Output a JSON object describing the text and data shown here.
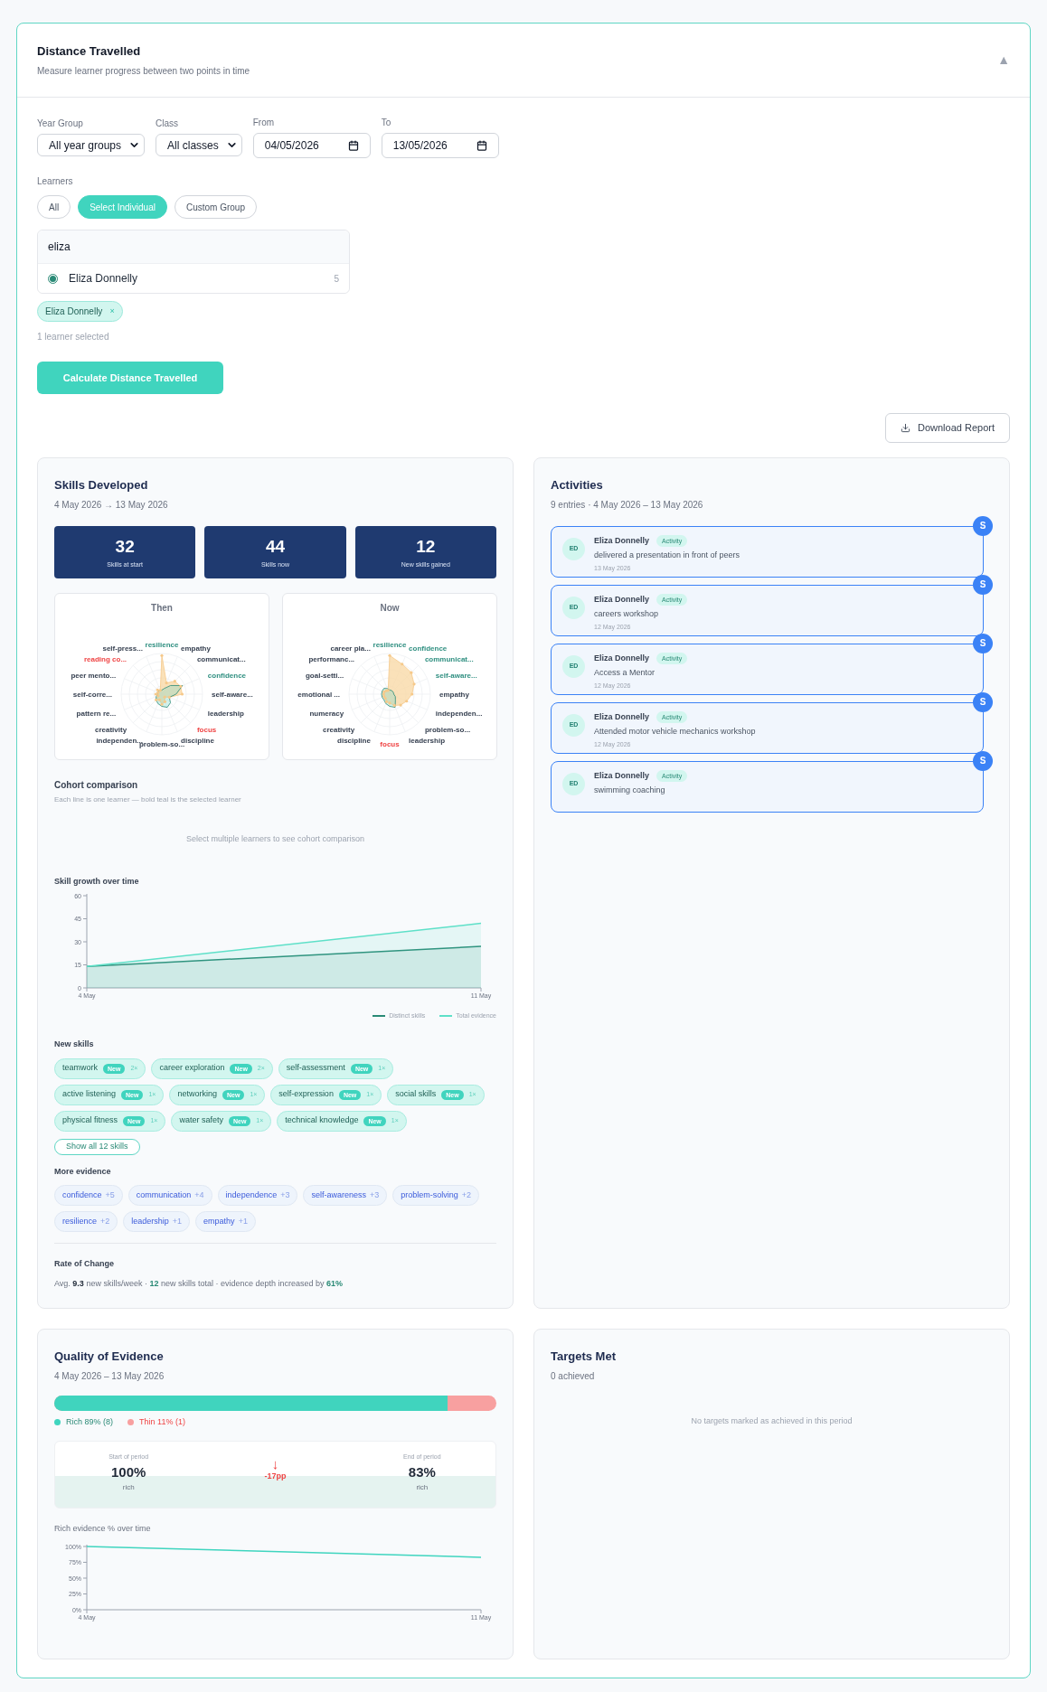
{
  "header": {
    "title": "Distance Travelled",
    "subtitle": "Measure learner progress between two points in time",
    "toggle": "▲"
  },
  "filters": [
    {
      "kind": "select",
      "label": "Year Group",
      "value": "All year groups"
    },
    {
      "kind": "select",
      "label": "Class",
      "value": "All classes"
    },
    {
      "kind": "date",
      "label": "From",
      "value": "04/05/2026"
    },
    {
      "kind": "date",
      "label": "To",
      "value": "13/05/2026"
    }
  ],
  "learners": {
    "label": "Learners",
    "modes": [
      {
        "label": "All",
        "selected": false
      },
      {
        "label": "Select Individual",
        "selected": true
      },
      {
        "label": "Custom Group",
        "selected": false
      }
    ],
    "search": {
      "value": "eliza"
    },
    "results": [
      {
        "name": "Eliza Donnelly",
        "count": "5",
        "selected": true
      }
    ],
    "chips": [
      {
        "label": "Eliza Donnelly",
        "remove": "×"
      }
    ],
    "selected_count": "1 learner selected"
  },
  "calculate_button": "Calculate Distance Travelled",
  "download_button": "Download Report",
  "skills": {
    "title": "Skills Developed",
    "date_range": "4 May 2026 → 13 May 2026",
    "stats": [
      {
        "value": "32",
        "label": "Skills at start"
      },
      {
        "value": "44",
        "label": "Skills now"
      },
      {
        "value": "12",
        "label": "New skills gained"
      }
    ],
    "radars": [
      {
        "title": "Then",
        "labels": [
          {
            "text": "resilience",
            "color": "#2f8f80"
          },
          {
            "text": "self-press...",
            "color": "#374151"
          },
          {
            "text": "empathy",
            "color": "#374151"
          },
          {
            "text": "reading co...",
            "color": "#ef4444"
          },
          {
            "text": "communicat...",
            "color": "#374151"
          },
          {
            "text": "peer mento...",
            "color": "#374151"
          },
          {
            "text": "confidence",
            "color": "#2f8f80"
          },
          {
            "text": "self-corre...",
            "color": "#374151"
          },
          {
            "text": "self-aware...",
            "color": "#374151"
          },
          {
            "text": "pattern re...",
            "color": "#374151"
          },
          {
            "text": "leadership",
            "color": "#374151"
          },
          {
            "text": "creativity",
            "color": "#374151"
          },
          {
            "text": "focus",
            "color": "#ef4444"
          },
          {
            "text": "independen...",
            "color": "#374151"
          },
          {
            "text": "discipline",
            "color": "#374151"
          },
          {
            "text": "problem-so...",
            "color": "#374151"
          }
        ]
      },
      {
        "title": "Now",
        "labels": [
          {
            "text": "resilience",
            "color": "#2f8f80"
          },
          {
            "text": "career pla...",
            "color": "#374151"
          },
          {
            "text": "confidence",
            "color": "#2f8f80"
          },
          {
            "text": "performanc...",
            "color": "#374151"
          },
          {
            "text": "communicat...",
            "color": "#2f8f80"
          },
          {
            "text": "goal-setti...",
            "color": "#374151"
          },
          {
            "text": "self-aware...",
            "color": "#2f8f80"
          },
          {
            "text": "emotional ...",
            "color": "#374151"
          },
          {
            "text": "empathy",
            "color": "#374151"
          },
          {
            "text": "numeracy",
            "color": "#374151"
          },
          {
            "text": "independen...",
            "color": "#374151"
          },
          {
            "text": "creativity",
            "color": "#374151"
          },
          {
            "text": "problem-so...",
            "color": "#374151"
          },
          {
            "text": "discipline",
            "color": "#374151"
          },
          {
            "text": "leadership",
            "color": "#374151"
          },
          {
            "text": "focus",
            "color": "#ef4444"
          }
        ]
      }
    ],
    "cohort": {
      "title": "Cohort comparison",
      "subtitle": "Each line is one learner — bold teal is the selected learner",
      "empty": "Select multiple learners to see cohort comparison"
    },
    "growth": {
      "chart_data": {
        "type": "area",
        "title": "Skill growth over time",
        "legend": "bottom-right",
        "x": [
          "4 May",
          "11 May"
        ],
        "ylim": [
          0,
          60
        ],
        "yticks": [
          0,
          15,
          30,
          45,
          60
        ],
        "series": [
          {
            "name": "Distinct skills",
            "color": "#2a8a76",
            "values": [
              14,
              27
            ]
          },
          {
            "name": "Total evidence",
            "color": "#5ee0c8",
            "values": [
              14,
              42
            ]
          }
        ]
      }
    },
    "new_skills": {
      "title": "New skills",
      "items": [
        {
          "name": "teamwork",
          "badge": "New",
          "count": "2×"
        },
        {
          "name": "career exploration",
          "badge": "New",
          "count": "2×"
        },
        {
          "name": "self-assessment",
          "badge": "New",
          "count": "1×"
        },
        {
          "name": "active listening",
          "badge": "New",
          "count": "1×"
        },
        {
          "name": "networking",
          "badge": "New",
          "count": "1×"
        },
        {
          "name": "self-expression",
          "badge": "New",
          "count": "1×"
        },
        {
          "name": "social skills",
          "badge": "New",
          "count": "1×"
        },
        {
          "name": "physical fitness",
          "badge": "New",
          "count": "1×"
        },
        {
          "name": "water safety",
          "badge": "New",
          "count": "1×"
        },
        {
          "name": "technical knowledge",
          "badge": "New",
          "count": "1×"
        }
      ],
      "show_all": "Show all 12 skills"
    },
    "more_evidence": {
      "title": "More evidence",
      "items": [
        {
          "name": "confidence",
          "delta": "+5"
        },
        {
          "name": "communication",
          "delta": "+4"
        },
        {
          "name": "independence",
          "delta": "+3"
        },
        {
          "name": "self-awareness",
          "delta": "+3"
        },
        {
          "name": "problem-solving",
          "delta": "+2"
        },
        {
          "name": "resilience",
          "delta": "+2"
        },
        {
          "name": "leadership",
          "delta": "+1"
        },
        {
          "name": "empathy",
          "delta": "+1"
        }
      ]
    },
    "rate": {
      "title": "Rate of Change",
      "parts": [
        {
          "kind": "plain",
          "text": "Avg. "
        },
        {
          "kind": "strong",
          "text": "9.3"
        },
        {
          "kind": "plain",
          "text": " new skills/week · "
        },
        {
          "kind": "accent",
          "text": "12"
        },
        {
          "kind": "plain",
          "text": " new skills total · evidence depth increased by "
        },
        {
          "kind": "accent",
          "text": "61%"
        }
      ]
    }
  },
  "activities": {
    "title": "Activities",
    "subtitle": "9 entries · 4 May 2026 – 13 May 2026",
    "items": [
      {
        "initials": "ED",
        "name": "Eliza Donnelly",
        "tag": "Activity",
        "text": "delivered a presentation in front of peers",
        "date": "13 May 2026",
        "badge": "S"
      },
      {
        "initials": "ED",
        "name": "Eliza Donnelly",
        "tag": "Activity",
        "text": "careers workshop",
        "date": "12 May 2026",
        "badge": "S"
      },
      {
        "initials": "ED",
        "name": "Eliza Donnelly",
        "tag": "Activity",
        "text": "Access a Mentor",
        "date": "12 May 2026",
        "badge": "S"
      },
      {
        "initials": "ED",
        "name": "Eliza Donnelly",
        "tag": "Activity",
        "text": "Attended motor vehicle mechanics workshop",
        "date": "12 May 2026",
        "badge": "S"
      },
      {
        "initials": "ED",
        "name": "Eliza Donnelly",
        "tag": "Activity",
        "text": "swimming coaching",
        "badge": "S"
      }
    ]
  },
  "quality": {
    "title": "Quality of Evidence",
    "date_range": "4 May 2026 – 13 May 2026",
    "level": 0.89,
    "legend": [
      {
        "label": "Rich 89% (8)",
        "color": "#3fd5bf"
      },
      {
        "label": "Thin 11% (1)",
        "color": "#f8a0a0"
      }
    ],
    "comparison": {
      "start_label": "Start of period",
      "start_value": "100%",
      "start_unit": "rich",
      "arrow": "↓",
      "change": "-17pp",
      "end_label": "End of period",
      "end_value": "83%",
      "end_unit": "rich"
    },
    "chart_data": {
      "type": "line",
      "title": "Rich evidence % over time",
      "x": [
        "4 May",
        "11 May"
      ],
      "ylim": [
        0,
        100
      ],
      "yticks": [
        {
          "value": 0,
          "label": "0%"
        },
        {
          "value": 25,
          "label": "25%"
        },
        {
          "value": 50,
          "label": "50%"
        },
        {
          "value": 75,
          "label": "75%"
        },
        {
          "value": 100,
          "label": "100%"
        }
      ],
      "series": [
        {
          "color": "#3fd5bf",
          "values": [
            100,
            83
          ]
        }
      ]
    }
  },
  "targets": {
    "title": "Targets Met",
    "subtitle": "0 achieved",
    "empty": "No targets marked as achieved in this period"
  }
}
